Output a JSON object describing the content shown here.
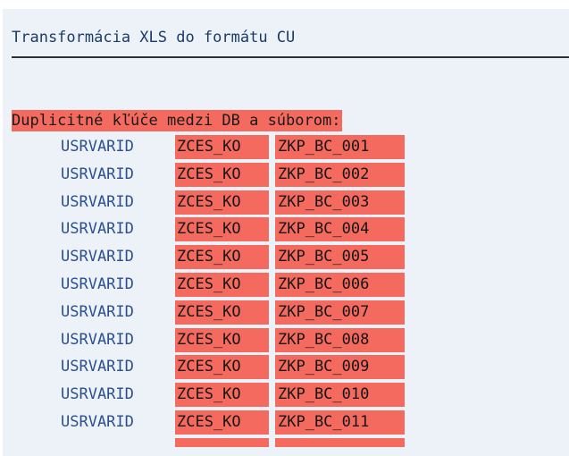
{
  "report": {
    "title": "Transformácia XLS do formátu CU",
    "section_header": "Duplicitné kľúče medzi DB a súborom:",
    "rows": [
      {
        "field": "USRVARID",
        "key1": "ZCES_KO",
        "key2": "ZKP_BC_001"
      },
      {
        "field": "USRVARID",
        "key1": "ZCES_KO",
        "key2": "ZKP_BC_002"
      },
      {
        "field": "USRVARID",
        "key1": "ZCES_KO",
        "key2": "ZKP_BC_003"
      },
      {
        "field": "USRVARID",
        "key1": "ZCES_KO",
        "key2": "ZKP_BC_004"
      },
      {
        "field": "USRVARID",
        "key1": "ZCES_KO",
        "key2": "ZKP_BC_005"
      },
      {
        "field": "USRVARID",
        "key1": "ZCES_KO",
        "key2": "ZKP_BC_006"
      },
      {
        "field": "USRVARID",
        "key1": "ZCES_KO",
        "key2": "ZKP_BC_007"
      },
      {
        "field": "USRVARID",
        "key1": "ZCES_KO",
        "key2": "ZKP_BC_008"
      },
      {
        "field": "USRVARID",
        "key1": "ZCES_KO",
        "key2": "ZKP_BC_009"
      },
      {
        "field": "USRVARID",
        "key1": "ZCES_KO",
        "key2": "ZKP_BC_010"
      },
      {
        "field": "USRVARID",
        "key1": "ZCES_KO",
        "key2": "ZKP_BC_011"
      }
    ]
  },
  "colors": {
    "background": "#edf2f9",
    "highlight": "#f46a5e",
    "field_text": "#2b4f8f",
    "title_text": "#1b3b66"
  }
}
